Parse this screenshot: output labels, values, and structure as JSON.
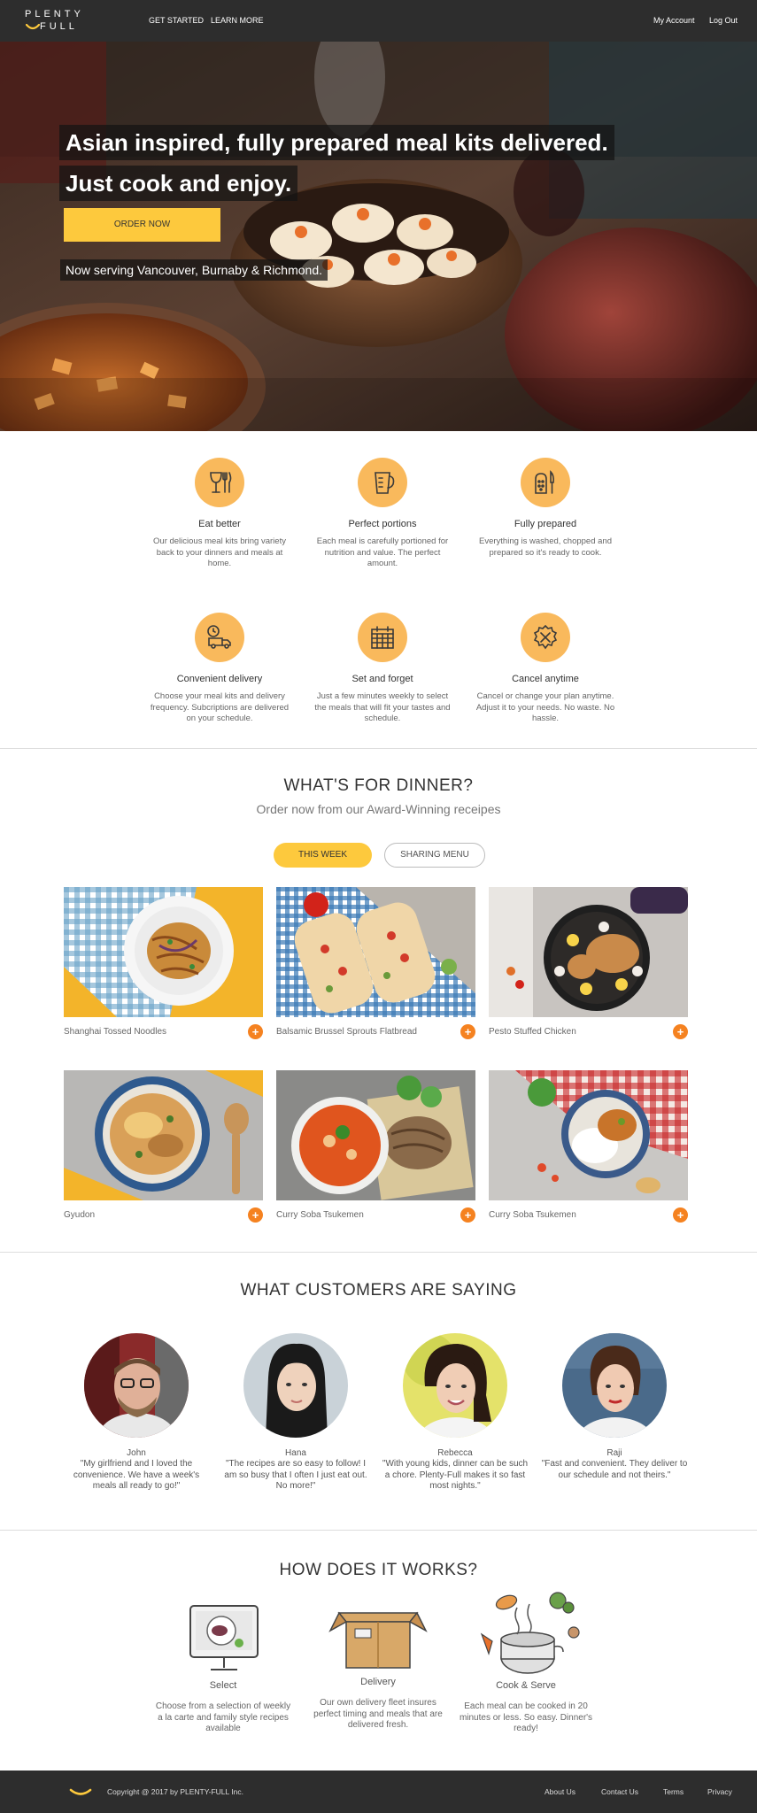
{
  "nav": {
    "logo_line1": "PLENTY",
    "logo_line2": "FULL",
    "get_started": "GET STARTED",
    "learn_more": "LEARN MORE",
    "my_account": "My Account",
    "log_out": "Log Out"
  },
  "hero": {
    "headline_line1": "Asian inspired, fully prepared meal kits delivered.",
    "headline_line2": "Just cook and enjoy.",
    "order_button": "ORDER NOW",
    "serving": "Now serving Vancouver, Burnaby & Richmond."
  },
  "features": [
    {
      "title": "Eat better",
      "desc": "Our delicious meal kits bring variety back to your dinners and meals at home.",
      "icon": "utensils-icon"
    },
    {
      "title": "Perfect portions",
      "desc": "Each meal is carefully portioned for nutrition and value. The perfect amount.",
      "icon": "measuring-cup-icon"
    },
    {
      "title": "Fully prepared",
      "desc": "Everything is washed, chopped and prepared so it's ready to cook.",
      "icon": "grater-knife-icon"
    },
    {
      "title": "Convenient delivery",
      "desc": "Choose your meal kits and delivery frequency. Subcriptions are delivered on your schedule.",
      "icon": "delivery-truck-icon"
    },
    {
      "title": "Set and forget",
      "desc": "Just a few minutes weekly to select the meals that will fit your tastes and schedule.",
      "icon": "calendar-icon"
    },
    {
      "title": "Cancel anytime",
      "desc": "Cancel or change your plan anytime. Adjust it to your needs. No waste. No hassle.",
      "icon": "cancel-icon"
    }
  ],
  "dinner": {
    "title": "WHAT'S FOR DINNER?",
    "subtitle": "Order now from our Award-Winning receipes",
    "tab_this_week": "THIS WEEK",
    "tab_sharing": "SHARING MENU",
    "add_symbol": "+",
    "meals": [
      {
        "name": "Shanghai Tossed Noodles"
      },
      {
        "name": "Balsamic Brussel Sprouts Flatbread"
      },
      {
        "name": "Pesto Stuffed Chicken"
      },
      {
        "name": "Gyudon"
      },
      {
        "name": "Curry Soba Tsukemen"
      },
      {
        "name": "Curry Soba Tsukemen"
      }
    ]
  },
  "testimonials": {
    "title": "WHAT CUSTOMERS ARE SAYING",
    "items": [
      {
        "name": "John",
        "quote": "\"My girlfriend and I loved the convenience. We have a week's meals all ready to go!\""
      },
      {
        "name": "Hana",
        "quote": "\"The recipes are so easy to follow! I am so busy that I often I just eat out. No more!\""
      },
      {
        "name": "Rebecca",
        "quote": "\"With young kids, dinner can be such a chore. Plenty-Full makes it so fast most nights.\""
      },
      {
        "name": "Raji",
        "quote": "\"Fast and convenient. They deliver to our schedule and not theirs.\""
      }
    ]
  },
  "how": {
    "title": "HOW DOES IT WORKS?",
    "steps": [
      {
        "title": "Select",
        "desc": "Choose from a selection of weekly a la carte and family style recipes available"
      },
      {
        "title": "Delivery",
        "desc": "Our own delivery fleet insures perfect timing and meals that are delivered fresh."
      },
      {
        "title": "Cook & Serve",
        "desc": "Each meal can be cooked in 20 minutes or less. So easy. Dinner's ready!"
      }
    ]
  },
  "footer": {
    "copyright": "Copyright @ 2017 by PLENTY-FULL Inc.",
    "about": "About Us",
    "contact": "Contact Us",
    "terms": "Terms",
    "privacy": "Privacy"
  },
  "colors": {
    "accent_yellow": "#fdc93d",
    "icon_circle": "#f9b95c",
    "add_orange": "#f58220",
    "dark_bar": "#2d2d2d"
  }
}
